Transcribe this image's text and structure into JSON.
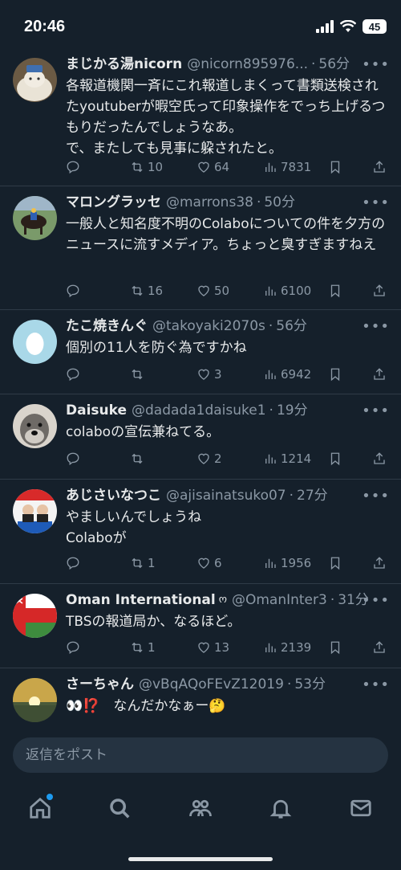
{
  "status": {
    "time": "20:46",
    "battery": "45"
  },
  "tweets": [
    {
      "name": "まじかる湯nicorn",
      "handle": "@nicorn895976...",
      "time": "56分",
      "text": "各報道機関一斉にこれ報道しまくって書類送検されたyoutuberが暇空氏って印象操作をでっち上げるつもりだったんでしょうなあ。\nで、またしても見事に躱されたと。",
      "replies": "",
      "retweets": "10",
      "likes": "64",
      "views": "7831"
    },
    {
      "name": "マロングラッセ",
      "handle": "@marrons38",
      "time": "50分",
      "text": "一般人と知名度不明のColaboについての件を夕方のニュースに流すメディア。ちょっと臭すぎますねえ",
      "replies": "",
      "retweets": "16",
      "likes": "50",
      "views": "6100"
    },
    {
      "name": "たこ焼きんぐ",
      "handle": "@takoyaki2070s",
      "time": "56分",
      "text": "個別の11人を防ぐ為ですかね",
      "replies": "",
      "retweets": "",
      "likes": "3",
      "views": "6942"
    },
    {
      "name": "Daisuke",
      "handle": "@dadada1daisuke1",
      "time": "19分",
      "text": "colaboの宣伝兼ねてる。",
      "replies": "",
      "retweets": "",
      "likes": "2",
      "views": "1214"
    },
    {
      "name": "あじさいなつこ",
      "handle": "@ajisainatsuko07",
      "time": "27分",
      "text": "やましいんでしょうね\nColaboが",
      "replies": "",
      "retweets": "1",
      "likes": "6",
      "views": "1956"
    },
    {
      "name": "Oman International",
      "verified_mark": "ო",
      "handle": "@OmanInter3",
      "time": "31分",
      "text": "TBSの報道局か、なるほど。",
      "replies": "",
      "retweets": "1",
      "likes": "13",
      "views": "2139"
    },
    {
      "name": "さーちゃん",
      "handle": "@vBqAQoFEvZ12019",
      "time": "53分",
      "text": "👀⁉️　なんだかなぁー🤔",
      "replies": "",
      "retweets": "",
      "likes": "",
      "views": ""
    }
  ],
  "reply_bar": {
    "placeholder": "返信をポスト"
  },
  "nav": {
    "items": [
      "home-icon",
      "search-icon",
      "communities-icon",
      "notifications-icon",
      "messages-icon"
    ],
    "accent": "#1d9bf0"
  },
  "colors": {
    "background": "#15202b",
    "text": "#e7e9ea",
    "secondary": "#8b98a5"
  }
}
